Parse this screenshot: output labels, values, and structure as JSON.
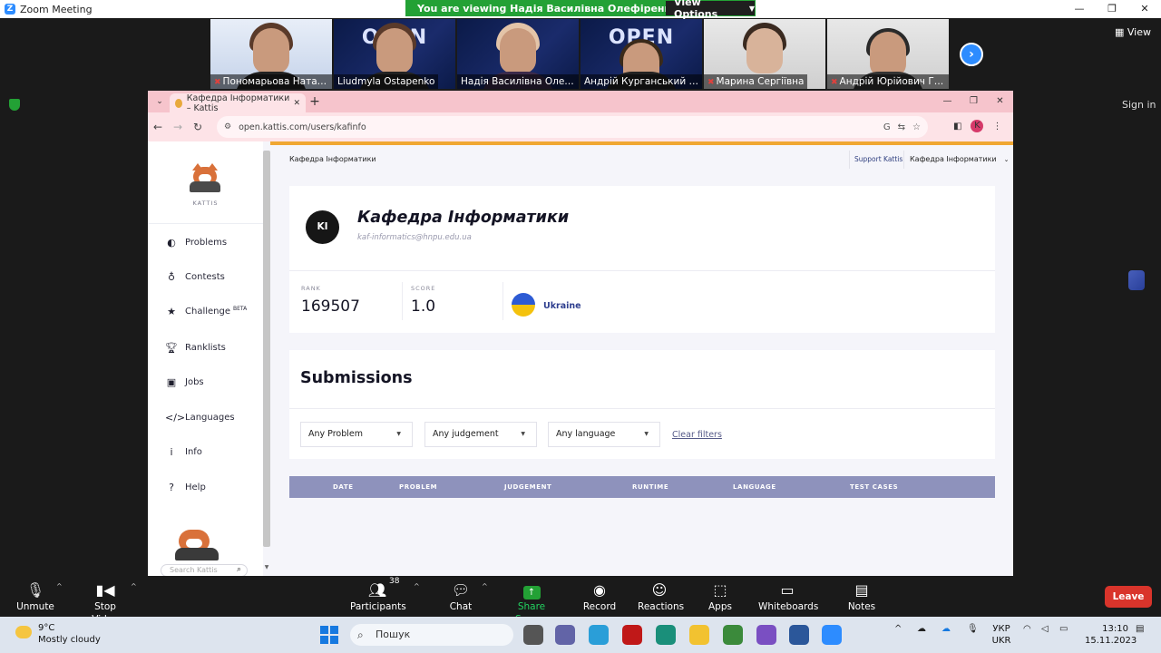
{
  "zoom": {
    "title": "Zoom Meeting",
    "viewing_banner": "You are viewing Надія Василівна Олефіренко's screen",
    "view_options": "View Options",
    "view_label": "View",
    "signin": "Sign in",
    "participants": [
      {
        "name": "Пономарьова Наталія…",
        "muted": true
      },
      {
        "name": "Liudmyla Ostapenko",
        "muted": false
      },
      {
        "name": "Надія Василівна Олефіре…",
        "muted": false
      },
      {
        "name": "Андрій Курганський 🔲",
        "muted": false
      },
      {
        "name": "Марина Сергіївна",
        "muted": true
      },
      {
        "name": "Андрій Юрійович Гай…",
        "muted": true
      }
    ],
    "tile_text": "OPEN",
    "toolbar": {
      "unmute": "Unmute",
      "stop_video": "Stop Video",
      "participants": "Participants",
      "participants_count": "38",
      "chat": "Chat",
      "share_screen": "Share Screen",
      "record": "Record",
      "reactions": "Reactions",
      "apps": "Apps",
      "whiteboards": "Whiteboards",
      "notes": "Notes",
      "leave": "Leave"
    }
  },
  "browser": {
    "tab_title": "Кафедра Інформатики – Kattis",
    "url": "open.kattis.com/users/kafinfo",
    "avatar_letter": "K"
  },
  "kattis": {
    "logo_label": "KATTIS",
    "nav": [
      {
        "label": "Problems",
        "icon": "problems-icon"
      },
      {
        "label": "Contests",
        "icon": "contests-icon"
      },
      {
        "label": "Challenge",
        "icon": "star-icon",
        "badge": "BETA"
      },
      {
        "label": "Ranklists",
        "icon": "trophy-icon"
      },
      {
        "label": "Jobs",
        "icon": "briefcase-icon"
      },
      {
        "label": "Languages",
        "icon": "code-icon"
      },
      {
        "label": "Info",
        "icon": "info-icon"
      },
      {
        "label": "Help",
        "icon": "help-icon"
      }
    ],
    "search_placeholder": "Search Kattis",
    "breadcrumb": "Кафедра Інформатики",
    "support": "Support Kattis",
    "user_menu": "Кафедра Інформатики",
    "profile": {
      "initials": "KI",
      "name": "Кафедра Інформатики",
      "email": "kaf-informatics@hnpu.edu.ua",
      "rank_label": "RANK",
      "rank": "169507",
      "score_label": "SCORE",
      "score": "1.0",
      "country": "Ukraine"
    },
    "submissions": {
      "title": "Submissions",
      "filters": [
        "Any Problem",
        "Any judgement",
        "Any language"
      ],
      "clear": "Clear filters",
      "columns": [
        "DATE",
        "PROBLEM",
        "JUDGEMENT",
        "RUNTIME",
        "LANGUAGE",
        "TEST CASES"
      ]
    }
  },
  "taskbar": {
    "temperature": "9°C",
    "weather": "Mostly cloudy",
    "search": "Пошук",
    "lang_top": "УКР",
    "lang_bottom": "UKR",
    "time": "13:10",
    "date": "15.11.2023"
  }
}
